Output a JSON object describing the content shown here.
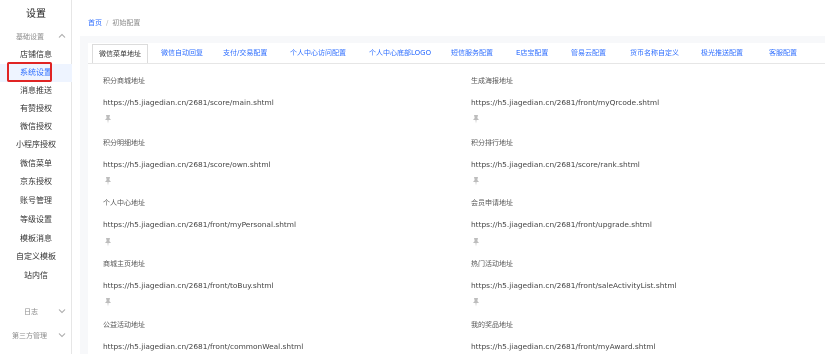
{
  "sidebar": {
    "title": "设置",
    "group_basic": "基础设置",
    "group_log": "日志",
    "group_third": "第三方管理",
    "items": [
      {
        "label": "店铺信息"
      },
      {
        "label": "系统设置"
      },
      {
        "label": "消息推送"
      },
      {
        "label": "有赞授权"
      },
      {
        "label": "微信授权"
      },
      {
        "label": "小程序授权"
      },
      {
        "label": "微信菜单"
      },
      {
        "label": "京东授权"
      },
      {
        "label": "账号管理"
      },
      {
        "label": "等级设置"
      },
      {
        "label": "模板消息"
      },
      {
        "label": "自定义模板"
      },
      {
        "label": "站内信"
      }
    ]
  },
  "breadcrumb": {
    "home": "首页",
    "separator": "/",
    "current": "初始配置"
  },
  "tabs": [
    {
      "label": "微信菜单地址"
    },
    {
      "label": "微信自动回复"
    },
    {
      "label": "支付/交易配置"
    },
    {
      "label": "个人中心访问配置"
    },
    {
      "label": "个人中心底部LOGO"
    },
    {
      "label": "短信服务配置"
    },
    {
      "label": "E店宝配置"
    },
    {
      "label": "管易云配置"
    },
    {
      "label": "货币名称自定义"
    },
    {
      "label": "极光推送配置"
    },
    {
      "label": "客服配置"
    }
  ],
  "fields": [
    {
      "label": "积分商城地址",
      "url": "https://h5.jiagedian.cn/2681/score/main.shtml"
    },
    {
      "label": "生成海报地址",
      "url": "https://h5.jiagedian.cn/2681/front/myQrcode.shtml"
    },
    {
      "label": "积分明细地址",
      "url": "https://h5.jiagedian.cn/2681/score/own.shtml"
    },
    {
      "label": "积分排行地址",
      "url": "https://h5.jiagedian.cn/2681/score/rank.shtml"
    },
    {
      "label": "个人中心地址",
      "url": "https://h5.jiagedian.cn/2681/front/myPersonal.shtml"
    },
    {
      "label": "会员申请地址",
      "url": "https://h5.jiagedian.cn/2681/front/upgrade.shtml"
    },
    {
      "label": "商城主页地址",
      "url": "https://h5.jiagedian.cn/2681/front/toBuy.shtml"
    },
    {
      "label": "热门活动地址",
      "url": "https://h5.jiagedian.cn/2681/front/saleActivityList.shtml"
    },
    {
      "label": "公益活动地址",
      "url": "https://h5.jiagedian.cn/2681/front/commonWeal.shtml"
    },
    {
      "label": "我的奖品地址",
      "url": "https://h5.jiagedian.cn/2681/front/myAward.shtml"
    }
  ],
  "icons": {
    "copy": "pin-icon",
    "chevron": "chevron-icon"
  },
  "colors": {
    "accent": "#2b6cff",
    "highlight": "#e02424"
  }
}
